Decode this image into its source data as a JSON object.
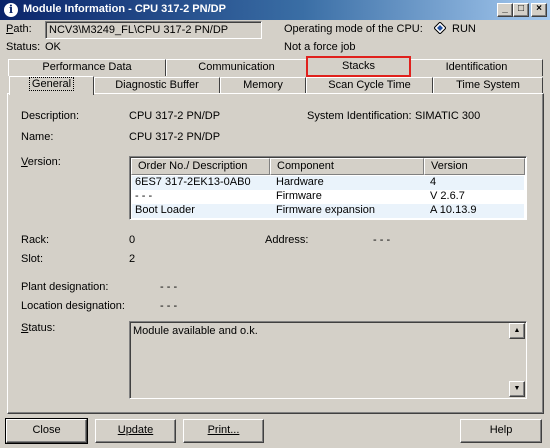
{
  "window": {
    "title": "Module Information - CPU 317-2 PN/DP",
    "icon_name": "info-icon",
    "controls": [
      "_",
      "□",
      "×"
    ]
  },
  "header": {
    "path_label": "Path:",
    "path_value": "NCV3\\M3249_FL\\CPU 317-2 PN/DP",
    "status_label": "Status:",
    "status_value": "OK",
    "mode_label": "Operating mode of the  CPU:",
    "mode_value": "RUN",
    "force_job": "Not a force job"
  },
  "tabs": {
    "row_back": [
      "Performance Data",
      "Communication",
      "Stacks",
      "Identification"
    ],
    "row_front": [
      "General",
      "Diagnostic Buffer",
      "Memory",
      "Scan Cycle Time",
      "Time System"
    ],
    "active": "General",
    "highlighted": "Stacks"
  },
  "general": {
    "description_label": "Description:",
    "description_value": "CPU 317-2 PN/DP",
    "sysid_label": "System Identification:",
    "sysid_value": "SIMATIC 300",
    "name_label": "Name:",
    "name_value": "CPU 317-2 PN/DP",
    "version_label": "Version:",
    "version_table": {
      "columns": [
        "Order No./ Description",
        "Component",
        "Version"
      ],
      "rows": [
        [
          "6ES7 317-2EK13-0AB0",
          "Hardware",
          "4"
        ],
        [
          "- - -",
          "Firmware",
          "V 2.6.7"
        ],
        [
          "Boot Loader",
          "Firmware expansion",
          "A 10.13.9"
        ]
      ]
    },
    "rack_label": "Rack:",
    "rack_value": "0",
    "address_label": "Address:",
    "address_value": "- - -",
    "slot_label": "Slot:",
    "slot_value": "2",
    "plant_label": "Plant designation:",
    "plant_value": "- - -",
    "location_label": "Location designation:",
    "location_value": "- - -",
    "status_label": "Status:",
    "status_text": "Module available and o.k."
  },
  "buttons": {
    "close": "Close",
    "update": "Update",
    "print": "Print...",
    "help": "Help"
  },
  "colors": {
    "titlebar": "#0a246a",
    "highlight_outline": "#e0201c",
    "dialog_bg": "#d4d0c8"
  }
}
